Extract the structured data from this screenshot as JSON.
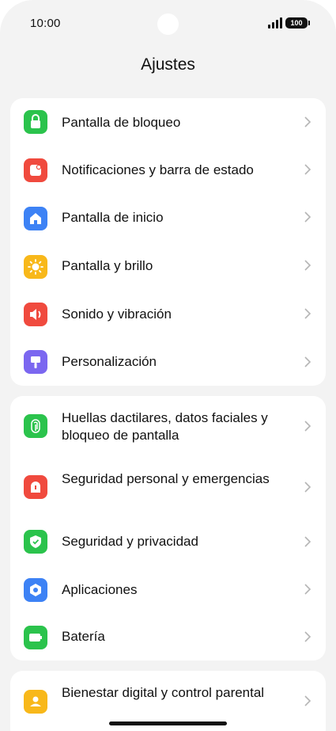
{
  "status_bar": {
    "time": "10:00",
    "battery": "100"
  },
  "header": {
    "title": "Ajustes"
  },
  "groups": [
    {
      "items": [
        {
          "label": "Pantalla de bloqueo",
          "icon": "lock-icon",
          "color": "#2bc34c"
        },
        {
          "label": "Notificaciones y barra de estado",
          "icon": "notification-icon",
          "color": "#f04a3e"
        },
        {
          "label": "Pantalla de inicio",
          "icon": "home-icon",
          "color": "#3d82f5"
        },
        {
          "label": "Pantalla y brillo",
          "icon": "sun-icon",
          "color": "#f8b81a"
        },
        {
          "label": "Sonido y vibración",
          "icon": "speaker-icon",
          "color": "#f04a3e"
        },
        {
          "label": "Personalización",
          "icon": "paintbrush-icon",
          "color": "#7b67f0"
        }
      ]
    },
    {
      "items": [
        {
          "label": "Huellas dactilares, datos faciales y bloqueo de pantalla",
          "icon": "fingerprint-icon",
          "color": "#2bc34c"
        },
        {
          "label": "Seguridad personal y emergencias",
          "icon": "emergency-icon",
          "color": "#f04a3e"
        },
        {
          "label": "Seguridad y privacidad",
          "icon": "shield-icon",
          "color": "#2bc34c"
        },
        {
          "label": "Aplicaciones",
          "icon": "apps-icon",
          "color": "#3d82f5"
        },
        {
          "label": "Batería",
          "icon": "battery-icon",
          "color": "#2bc34c"
        }
      ]
    },
    {
      "items": [
        {
          "label": "Bienestar digital y control parental",
          "icon": "wellbeing-icon",
          "color": "#f8b81a"
        }
      ]
    }
  ]
}
